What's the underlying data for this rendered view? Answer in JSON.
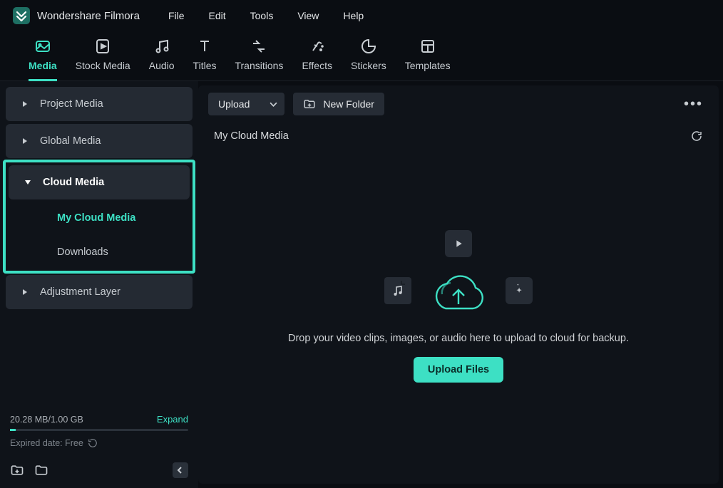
{
  "app": {
    "title": "Wondershare Filmora"
  },
  "menu": {
    "file": "File",
    "edit": "Edit",
    "tools": "Tools",
    "view": "View",
    "help": "Help"
  },
  "tabs": {
    "media": "Media",
    "stock": "Stock Media",
    "audio": "Audio",
    "titles": "Titles",
    "transitions": "Transitions",
    "effects": "Effects",
    "stickers": "Stickers",
    "templates": "Templates"
  },
  "sidebar": {
    "project_media": "Project Media",
    "global_media": "Global Media",
    "cloud_media": "Cloud Media",
    "my_cloud_media": "My Cloud Media",
    "downloads": "Downloads",
    "adjustment_layer": "Adjustment Layer"
  },
  "storage": {
    "usage": "20.28 MB/1.00 GB",
    "expand": "Expand",
    "expired": "Expired date: Free"
  },
  "toolbar": {
    "upload": "Upload",
    "new_folder": "New Folder"
  },
  "main": {
    "section_title": "My Cloud Media",
    "drop_text": "Drop your video clips, images, or audio here to upload to cloud for backup.",
    "upload_files": "Upload Files"
  }
}
